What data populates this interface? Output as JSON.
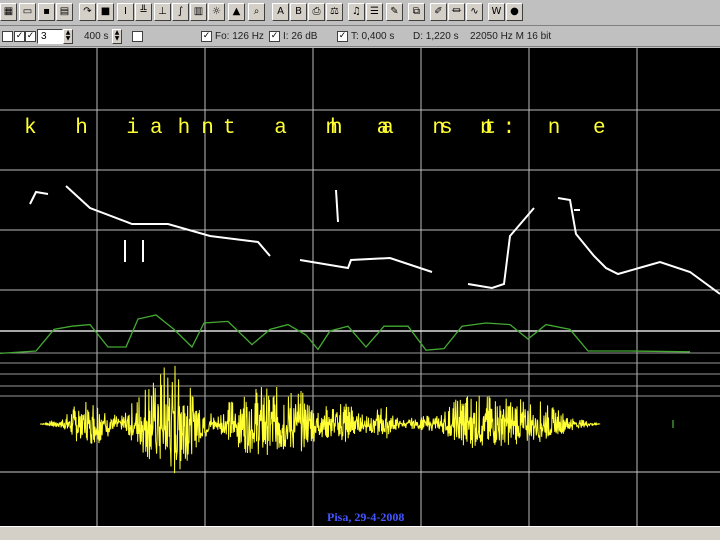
{
  "colors": {
    "background": "#000000",
    "grid": "#bdbdbd",
    "pitch": "#ffffff",
    "intensity": "#44aa33",
    "waveform": "#ffff33",
    "phonetic_text": "#ffff33",
    "caption": "#4455ff"
  },
  "toolbar": {
    "buttons": [
      {
        "icon": "grid-view-icon",
        "glyph": "▦"
      },
      {
        "icon": "open-file-icon",
        "glyph": "▭"
      },
      {
        "icon": "save-icon",
        "glyph": "▪"
      },
      {
        "icon": "print-icon",
        "glyph": "▤"
      },
      {
        "icon": "record-icon",
        "glyph": "↷"
      },
      {
        "icon": "stop-icon",
        "glyph": "■"
      },
      {
        "icon": "cursor-icon",
        "glyph": "I"
      },
      {
        "icon": "pitch-marker-icon",
        "glyph": "╩"
      },
      {
        "icon": "segment-icon",
        "glyph": "⊥"
      },
      {
        "icon": "pitch-curve-icon",
        "glyph": "∫"
      },
      {
        "icon": "spectrum-icon",
        "glyph": "▥"
      },
      {
        "icon": "settings-icon",
        "glyph": "☼"
      },
      {
        "icon": "hat-icon",
        "glyph": "▲"
      },
      {
        "icon": "zoom-icon",
        "glyph": "⌕"
      },
      {
        "icon": "label-a-icon",
        "glyph": "A"
      },
      {
        "icon": "label-b-icon",
        "glyph": "B"
      },
      {
        "icon": "printer-icon",
        "glyph": "⎙"
      },
      {
        "icon": "scale-icon",
        "glyph": "⚖"
      },
      {
        "icon": "note-icon",
        "glyph": "♫"
      },
      {
        "icon": "list-icon",
        "glyph": "☰"
      },
      {
        "icon": "edit-icon",
        "glyph": "✎"
      },
      {
        "icon": "copy-icon",
        "glyph": "⧉"
      },
      {
        "icon": "pen-icon",
        "glyph": "✐"
      },
      {
        "icon": "filter-icon",
        "glyph": "⏛"
      },
      {
        "icon": "wave-icon",
        "glyph": "∿"
      },
      {
        "icon": "waveform-view-icon",
        "glyph": "W"
      },
      {
        "icon": "color-icon",
        "glyph": "●"
      }
    ]
  },
  "statusbar": {
    "spin_value": "3",
    "time_scale": "400 s",
    "f0": "Fo: 126 Hz",
    "level": "I: 26 dB",
    "time_mark": "T: 0,400 s",
    "duration": "D: 1,220 s",
    "sample_info": "22050 Hz  M 16 bit"
  },
  "phonetic": {
    "segments": [
      "k h i h",
      "a n",
      "t a n a",
      "h a n t",
      "s",
      "ɒ: n e"
    ]
  },
  "caption": "Pisa, 29-4-2008",
  "chart_data": [
    {
      "type": "line",
      "series": [
        {
          "values": [
            [
              0.1,
              340
            ],
            [
              0.12,
              328
            ],
            [
              0.16,
              330
            ],
            [
              0.22,
              322
            ],
            [
              0.3,
              344
            ],
            [
              0.44,
              360
            ],
            [
              0.56,
              360
            ],
            [
              0.7,
              372
            ],
            [
              0.86,
              378
            ],
            [
              0.9,
              392
            ],
            [
              1.0,
              396
            ],
            [
              1.16,
              404
            ],
            [
              1.17,
              396
            ],
            [
              1.3,
              394
            ],
            [
              1.44,
              408
            ],
            [
              1.56,
              420
            ],
            [
              1.64,
              424
            ],
            [
              1.68,
              420
            ],
            [
              1.7,
              372
            ],
            [
              1.78,
              344
            ],
            [
              1.86,
              334
            ],
            [
              1.9,
              336
            ],
            [
              1.92,
              370
            ],
            [
              1.98,
              392
            ],
            [
              2.02,
              404
            ],
            [
              2.06,
              410
            ],
            [
              2.13,
              404
            ],
            [
              2.2,
              398
            ],
            [
              2.3,
              408
            ],
            [
              2.4,
              430
            ]
          ]
        }
      ]
    },
    {
      "type": "line",
      "series": [
        {
          "values": [
            [
              0,
              0.52
            ],
            [
              0.12,
              0.55
            ],
            [
              0.18,
              0.82
            ],
            [
              0.24,
              0.86
            ],
            [
              0.3,
              0.88
            ],
            [
              0.36,
              0.6
            ],
            [
              0.42,
              0.6
            ],
            [
              0.46,
              0.95
            ],
            [
              0.52,
              1.0
            ],
            [
              0.58,
              0.82
            ],
            [
              0.64,
              0.6
            ],
            [
              0.68,
              0.9
            ],
            [
              0.76,
              0.92
            ],
            [
              0.84,
              0.63
            ],
            [
              0.9,
              0.82
            ],
            [
              0.96,
              0.88
            ],
            [
              1.02,
              0.75
            ],
            [
              1.06,
              0.57
            ],
            [
              1.1,
              0.8
            ],
            [
              1.16,
              0.86
            ],
            [
              1.22,
              0.6
            ],
            [
              1.28,
              0.86
            ],
            [
              1.36,
              0.86
            ],
            [
              1.42,
              0.56
            ],
            [
              1.48,
              0.58
            ],
            [
              1.54,
              0.86
            ],
            [
              1.62,
              0.9
            ],
            [
              1.7,
              0.88
            ],
            [
              1.76,
              0.7
            ],
            [
              1.82,
              0.88
            ],
            [
              1.9,
              0.82
            ],
            [
              1.96,
              0.55
            ],
            [
              2.1,
              0.55
            ],
            [
              2.3,
              0.54
            ]
          ]
        }
      ]
    }
  ]
}
